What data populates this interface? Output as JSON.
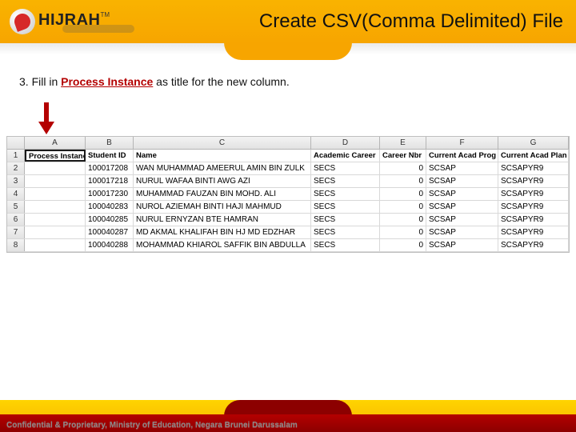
{
  "logo": {
    "text": "HIJRAH",
    "tm": "TM"
  },
  "page_title": "Create CSV(Comma Delimited) File",
  "instruction": {
    "step": "3. Fill in ",
    "highlight": "Process Instance",
    "rest": " as title for the new column."
  },
  "col_letters": [
    "A",
    "B",
    "C",
    "D",
    "E",
    "F",
    "G"
  ],
  "headers": [
    "Process Instance",
    "Student ID",
    "Name",
    "Academic Career",
    "Career Nbr",
    "Current Acad Prog",
    "Current Acad Plan"
  ],
  "rows": [
    {
      "n": "1"
    },
    {
      "n": "2",
      "id": "100017208",
      "name": "WAN MUHAMMAD AMEERUL AMIN BIN ZULK",
      "career": "SECS",
      "nbr": "0",
      "prog": "SCSAP",
      "plan": "SCSAPYR9"
    },
    {
      "n": "3",
      "id": "100017218",
      "name": "NURUL WAFAA BINTI AWG AZI",
      "career": "SECS",
      "nbr": "0",
      "prog": "SCSAP",
      "plan": "SCSAPYR9"
    },
    {
      "n": "4",
      "id": "100017230",
      "name": "MUHAMMAD FAUZAN BIN MOHD. ALI",
      "career": "SECS",
      "nbr": "0",
      "prog": "SCSAP",
      "plan": "SCSAPYR9"
    },
    {
      "n": "5",
      "id": "100040283",
      "name": "NUROL AZIEMAH BINTI HAJI MAHMUD",
      "career": "SECS",
      "nbr": "0",
      "prog": "SCSAP",
      "plan": "SCSAPYR9"
    },
    {
      "n": "6",
      "id": "100040285",
      "name": "NURUL ERNYZAN BTE HAMRAN",
      "career": "SECS",
      "nbr": "0",
      "prog": "SCSAP",
      "plan": "SCSAPYR9"
    },
    {
      "n": "7",
      "id": "100040287",
      "name": "MD AKMAL KHALIFAH BIN HJ MD EDZHAR",
      "career": "SECS",
      "nbr": "0",
      "prog": "SCSAP",
      "plan": "SCSAPYR9"
    },
    {
      "n": "8",
      "id": "100040288",
      "name": "MOHAMMAD KHIAROL SAFFIK BIN ABDULLA",
      "career": "SECS",
      "nbr": "0",
      "prog": "SCSAP",
      "plan": "SCSAPYR9"
    }
  ],
  "footer_text": "Confidential & Proprietary, Ministry of Education, Negara Brunei Darussalam"
}
